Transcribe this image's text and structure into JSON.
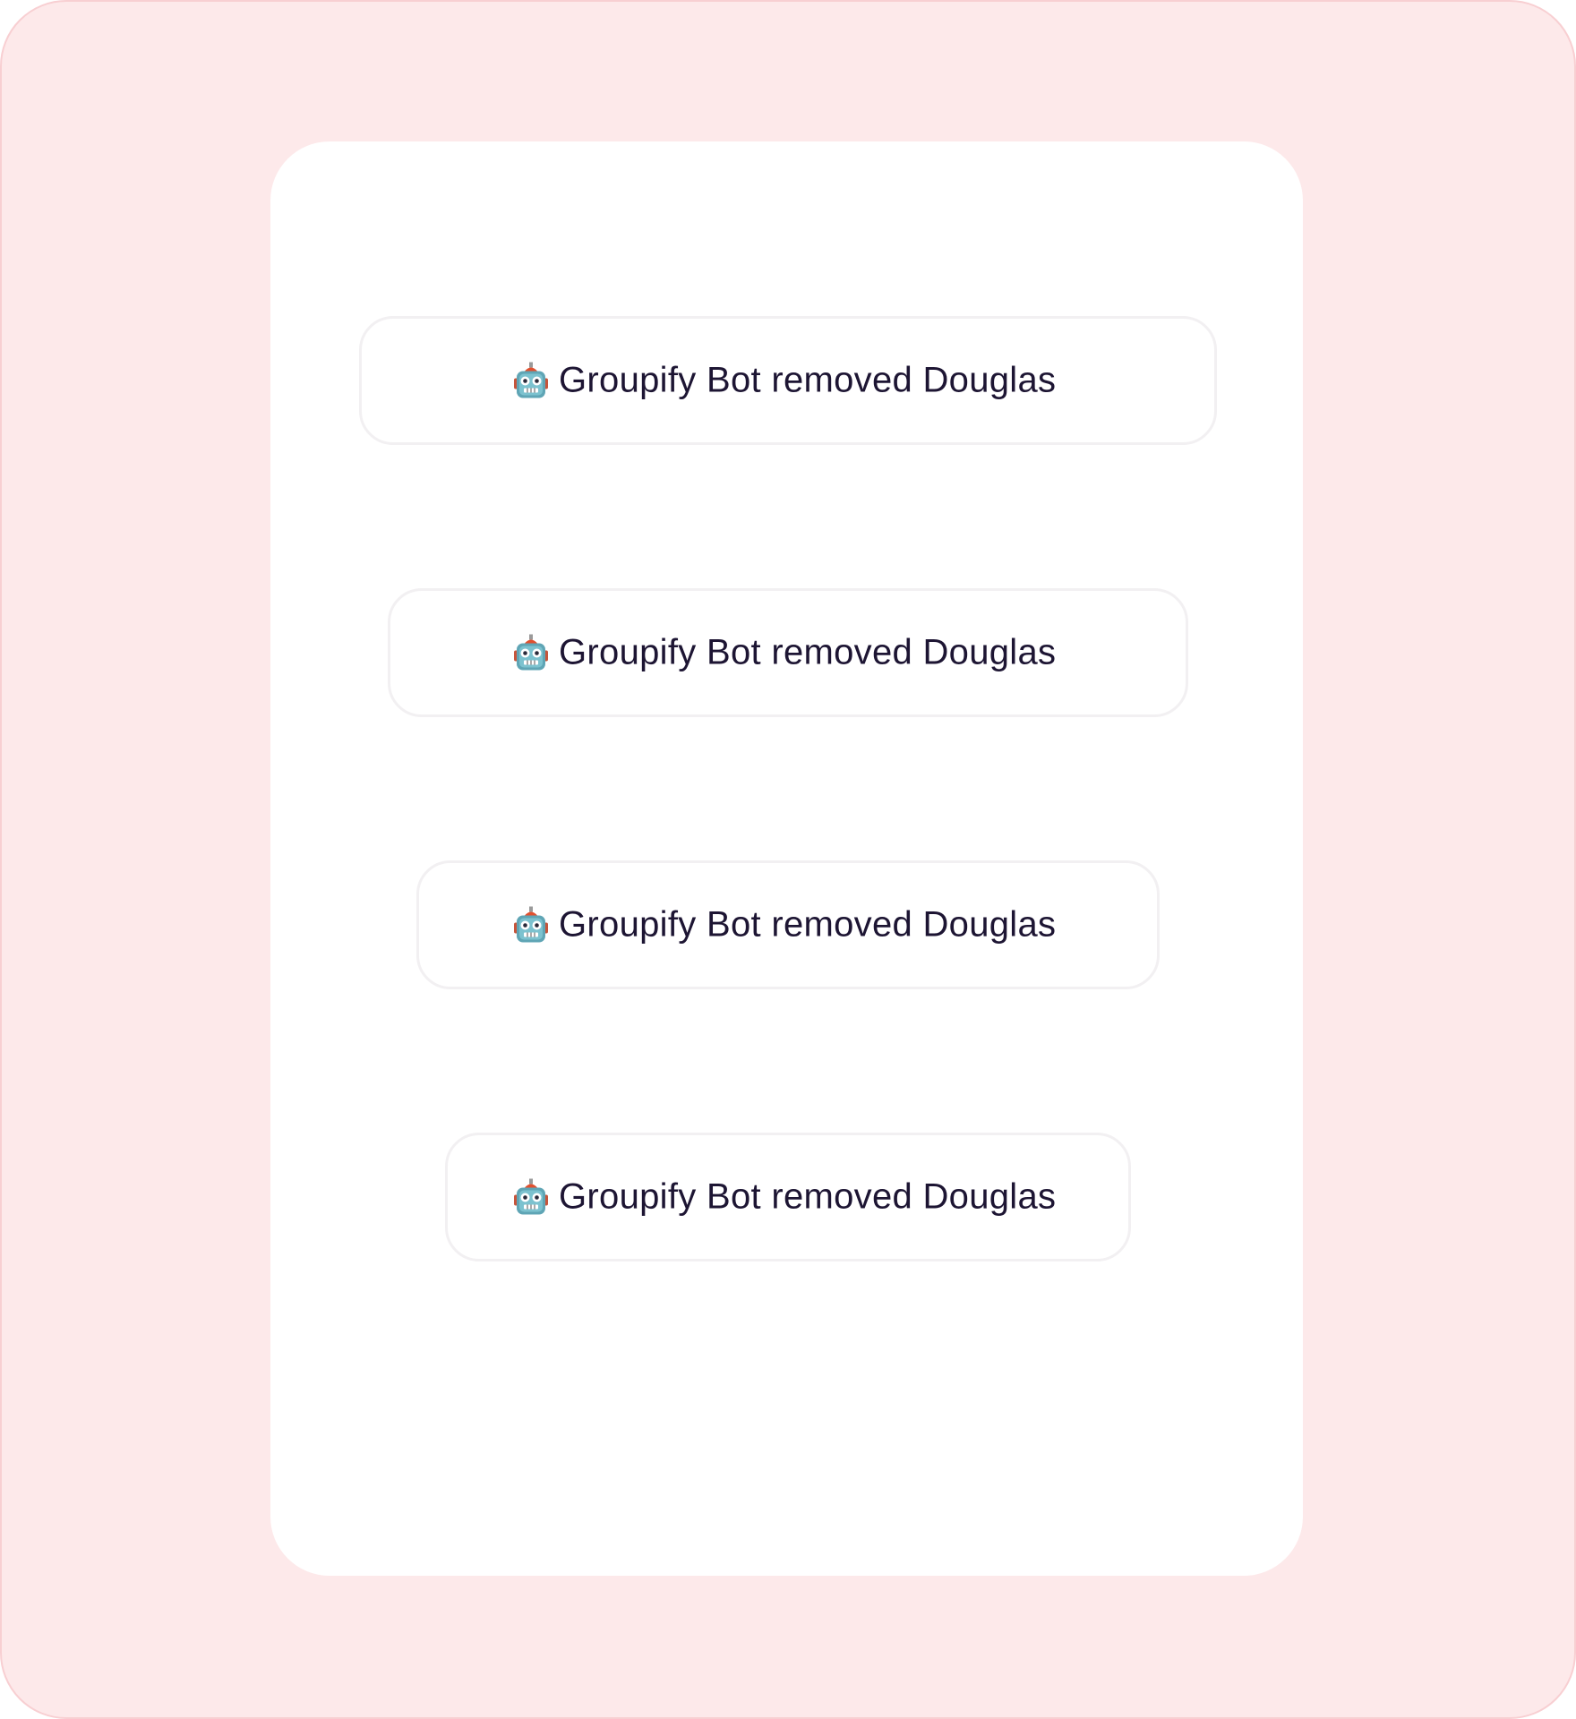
{
  "notifications": [
    {
      "icon": "robot-icon",
      "text": "Groupify Bot removed Douglas"
    },
    {
      "icon": "robot-icon",
      "text": "Groupify Bot removed Douglas"
    },
    {
      "icon": "robot-icon",
      "text": "Groupify Bot removed Douglas"
    },
    {
      "icon": "robot-icon",
      "text": "Groupify Bot removed Douglas"
    }
  ],
  "colors": {
    "outer_background": "#fde9ea",
    "outer_border": "#f8cfd2",
    "card_background": "#ffffff",
    "pill_border": "#f2f0f2",
    "text": "#1d1533"
  }
}
